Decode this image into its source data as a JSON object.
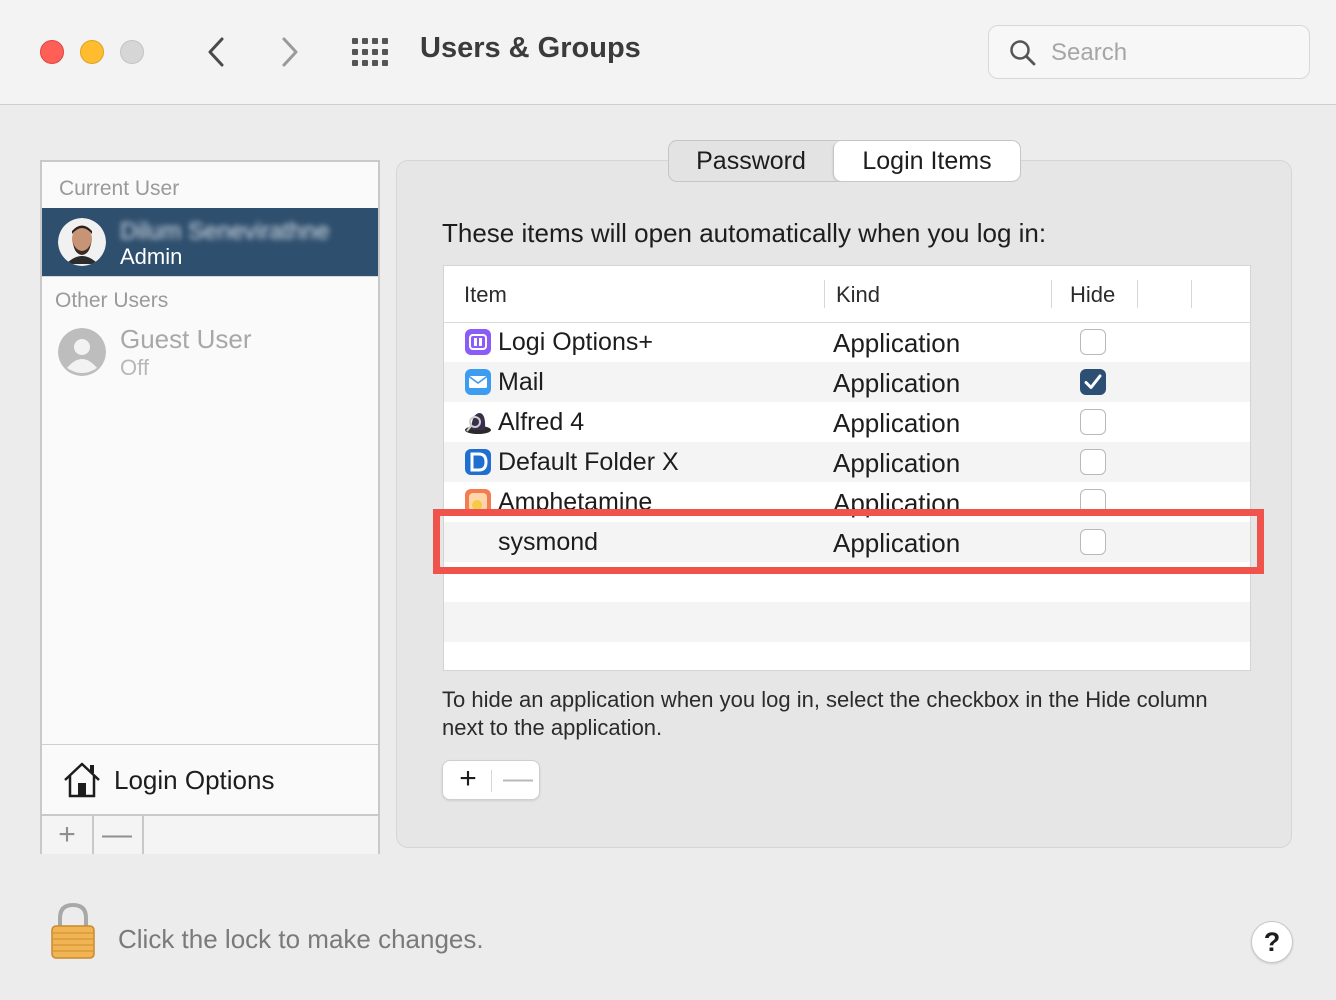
{
  "window": {
    "title": "Users & Groups",
    "search_placeholder": "Search"
  },
  "sidebar": {
    "current_user_header": "Current User",
    "current_user": {
      "name": "Dilum Senevirathne",
      "role": "Admin"
    },
    "other_users_header": "Other Users",
    "guest": {
      "name": "Guest User",
      "status": "Off"
    },
    "login_options": "Login Options",
    "add_symbol": "+",
    "remove_symbol": "—"
  },
  "tabs": [
    "Password",
    "Login Items"
  ],
  "selected_tab": "Login Items",
  "intro": "These items will open automatically when you log in:",
  "table": {
    "headers": [
      "Item",
      "Kind",
      "Hide"
    ],
    "rows": [
      {
        "name": "Logi Options+",
        "kind": "Application",
        "hide": false,
        "icon": "logi-options-icon"
      },
      {
        "name": "Mail",
        "kind": "Application",
        "hide": true,
        "icon": "mail-icon"
      },
      {
        "name": "Alfred 4",
        "kind": "Application",
        "hide": false,
        "icon": "alfred-icon"
      },
      {
        "name": "Default Folder X",
        "kind": "Application",
        "hide": false,
        "icon": "default-folder-icon"
      },
      {
        "name": "Amphetamine",
        "kind": "Application",
        "hide": false,
        "icon": "amphetamine-icon"
      },
      {
        "name": "sysmond",
        "kind": "Application",
        "hide": false,
        "icon": ""
      }
    ],
    "highlighted_row": "sysmond",
    "highlight_color": "#f0534b"
  },
  "hint": "To hide an application when you log in, select the checkbox in the Hide column next to the application.",
  "controls": {
    "add_symbol": "+",
    "remove_symbol": "—"
  },
  "lock_text": "Click the lock to make changes.",
  "help_symbol": "?",
  "colors": {
    "selection": "#2f4f6e",
    "checkbox_on": "#2c4f73"
  }
}
